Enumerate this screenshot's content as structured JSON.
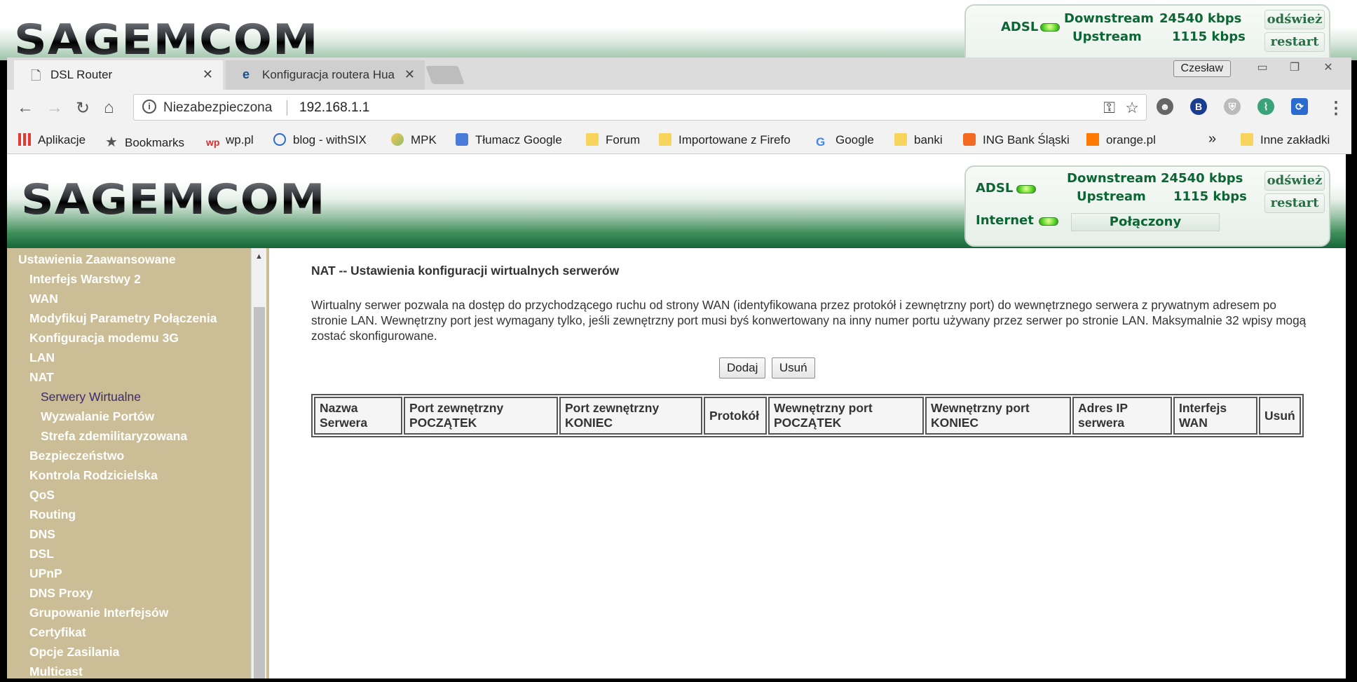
{
  "router": {
    "logo": "SAGEMCOM",
    "adsl_label": "ADSL",
    "internet_label": "Internet",
    "downstream_label": "Downstream",
    "upstream_label": "Upstream",
    "downstream_value": "24540 kbps",
    "upstream_value": "1115 kbps",
    "refresh_label": "odśwież",
    "restart_label": "restart",
    "connection_status": "Połączony"
  },
  "browser": {
    "tabs": [
      {
        "label": "DSL Router",
        "active": true
      },
      {
        "label": "Konfiguracja routera Hua",
        "active": false
      }
    ],
    "profile_name": "Czesław",
    "security_text": "Niezabezpieczona",
    "url": "192.168.1.1",
    "bookmarks": [
      {
        "label": "Aplikacje",
        "icon": "apps-grid-icon"
      },
      {
        "label": "Bookmarks",
        "icon": "star-icon"
      },
      {
        "label": "wp.pl",
        "icon": "wp-icon"
      },
      {
        "label": "blog - withSIX",
        "icon": "withsix-icon"
      },
      {
        "label": "MPK",
        "icon": "mpk-icon"
      },
      {
        "label": "Tłumacz Google",
        "icon": "translate-icon"
      },
      {
        "label": "Forum",
        "icon": "folder-icon"
      },
      {
        "label": "Importowane z Firefo",
        "icon": "folder-icon"
      },
      {
        "label": "Google",
        "icon": "google-icon"
      },
      {
        "label": "banki",
        "icon": "folder-icon"
      },
      {
        "label": "ING Bank Śląski",
        "icon": "ing-icon"
      },
      {
        "label": "orange.pl",
        "icon": "orange-icon"
      }
    ],
    "more_label": "»",
    "other_bookmarks": "Inne zakładki",
    "extension_badge": "B"
  },
  "sidebar": {
    "items": [
      {
        "label": "Ustawienia Zaawansowane",
        "level": 0
      },
      {
        "label": "Interfejs Warstwy 2",
        "level": 1
      },
      {
        "label": "WAN",
        "level": 1
      },
      {
        "label": "Modyfikuj Parametry Połączenia",
        "level": 1
      },
      {
        "label": "Konfiguracja modemu 3G",
        "level": 1
      },
      {
        "label": "LAN",
        "level": 1
      },
      {
        "label": "NAT",
        "level": 1
      },
      {
        "label": "Serwery Wirtualne",
        "level": 2,
        "selected": true
      },
      {
        "label": "Wyzwalanie Portów",
        "level": 2
      },
      {
        "label": "Strefa zdemilitaryzowana",
        "level": 2
      },
      {
        "label": "Bezpieczeństwo",
        "level": 1
      },
      {
        "label": "Kontrola Rodzicielska",
        "level": 1
      },
      {
        "label": "QoS",
        "level": 1
      },
      {
        "label": "Routing",
        "level": 1
      },
      {
        "label": "DNS",
        "level": 1
      },
      {
        "label": "DSL",
        "level": 1
      },
      {
        "label": "UPnP",
        "level": 1
      },
      {
        "label": "DNS Proxy",
        "level": 1
      },
      {
        "label": "Grupowanie Interfejsów",
        "level": 1
      },
      {
        "label": "Certyfikat",
        "level": 1
      },
      {
        "label": "Opcje Zasilania",
        "level": 1
      },
      {
        "label": "Multicast",
        "level": 1
      }
    ]
  },
  "main": {
    "title": "NAT -- Ustawienia konfiguracji wirtualnych serwerów",
    "description": "Wirtualny serwer pozwala na dostęp do przychodzącego ruchu od strony WAN (identyfikowana przez protokół i zewnętrzny port) do wewnętrznego serwera z prywatnym adresem po stronie LAN. Wewnętrzny port jest wymagany tylko, jeśli zewnętrzny port musi byś konwertowany na inny numer portu używany przez serwer po stronie LAN. Maksymalnie 32 wpisy mogą zostać skonfigurowane.",
    "add_button": "Dodaj",
    "remove_button": "Usuń",
    "table_headers": [
      [
        "Nazwa",
        "Serwera"
      ],
      [
        "Port zewnętrzny",
        "POCZĄTEK"
      ],
      [
        "Port zewnętrzny",
        "KONIEC"
      ],
      [
        "Protokół",
        ""
      ],
      [
        "Wewnętrzny port",
        "POCZĄTEK"
      ],
      [
        "Wewnętrzny port",
        "KONIEC"
      ],
      [
        "Adres IP",
        "serwera"
      ],
      [
        "Interfejs",
        "WAN"
      ],
      [
        "Usuń",
        ""
      ]
    ]
  }
}
